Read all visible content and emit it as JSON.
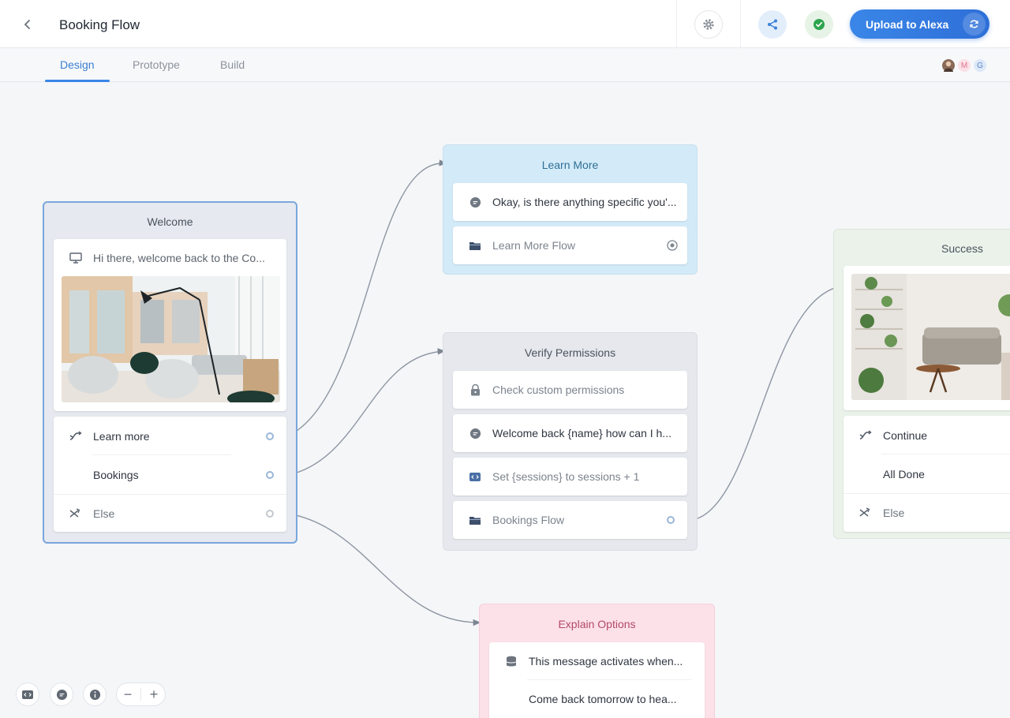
{
  "header": {
    "title": "Booking Flow",
    "upload_label": "Upload to Alexa"
  },
  "tabs": [
    {
      "label": "Design",
      "active": true
    },
    {
      "label": "Prototype",
      "active": false
    },
    {
      "label": "Build",
      "active": false
    }
  ],
  "collaborators": [
    "M",
    "G"
  ],
  "blocks": {
    "welcome": {
      "title": "Welcome",
      "speak": "Hi there, welcome back to the Co...",
      "choices": [
        "Learn more",
        "Bookings"
      ],
      "else_label": "Else"
    },
    "learn_more": {
      "title": "Learn More",
      "speak": "Okay, is there anything specific you'...",
      "flow": "Learn More Flow"
    },
    "verify": {
      "title": "Verify Permissions",
      "permissions": "Check custom permissions",
      "speak": "Welcome back {name} how can I h...",
      "set": "Set {sessions} to sessions + 1",
      "flow": "Bookings Flow"
    },
    "success": {
      "title": "Success",
      "choices": [
        "Continue",
        "All Done"
      ],
      "else_label": "Else"
    },
    "explain": {
      "title": "Explain Options",
      "lines": [
        "This message activates when...",
        "Come back tomorrow to hea..."
      ]
    }
  },
  "colors": {
    "accent": "#3a86e8",
    "learn_more_bg": "#d3ebf8",
    "explain_bg": "#fde1e8",
    "success_bg": "#eaf2ea"
  },
  "icons": [
    "chevron-left-icon",
    "gear-icon",
    "share-icon",
    "check-circle-icon",
    "sync-icon",
    "monitor-icon",
    "shuffle-icon",
    "chat-icon",
    "folder-icon",
    "lock-icon",
    "code-icon",
    "database-icon",
    "info-icon",
    "target-icon"
  ]
}
